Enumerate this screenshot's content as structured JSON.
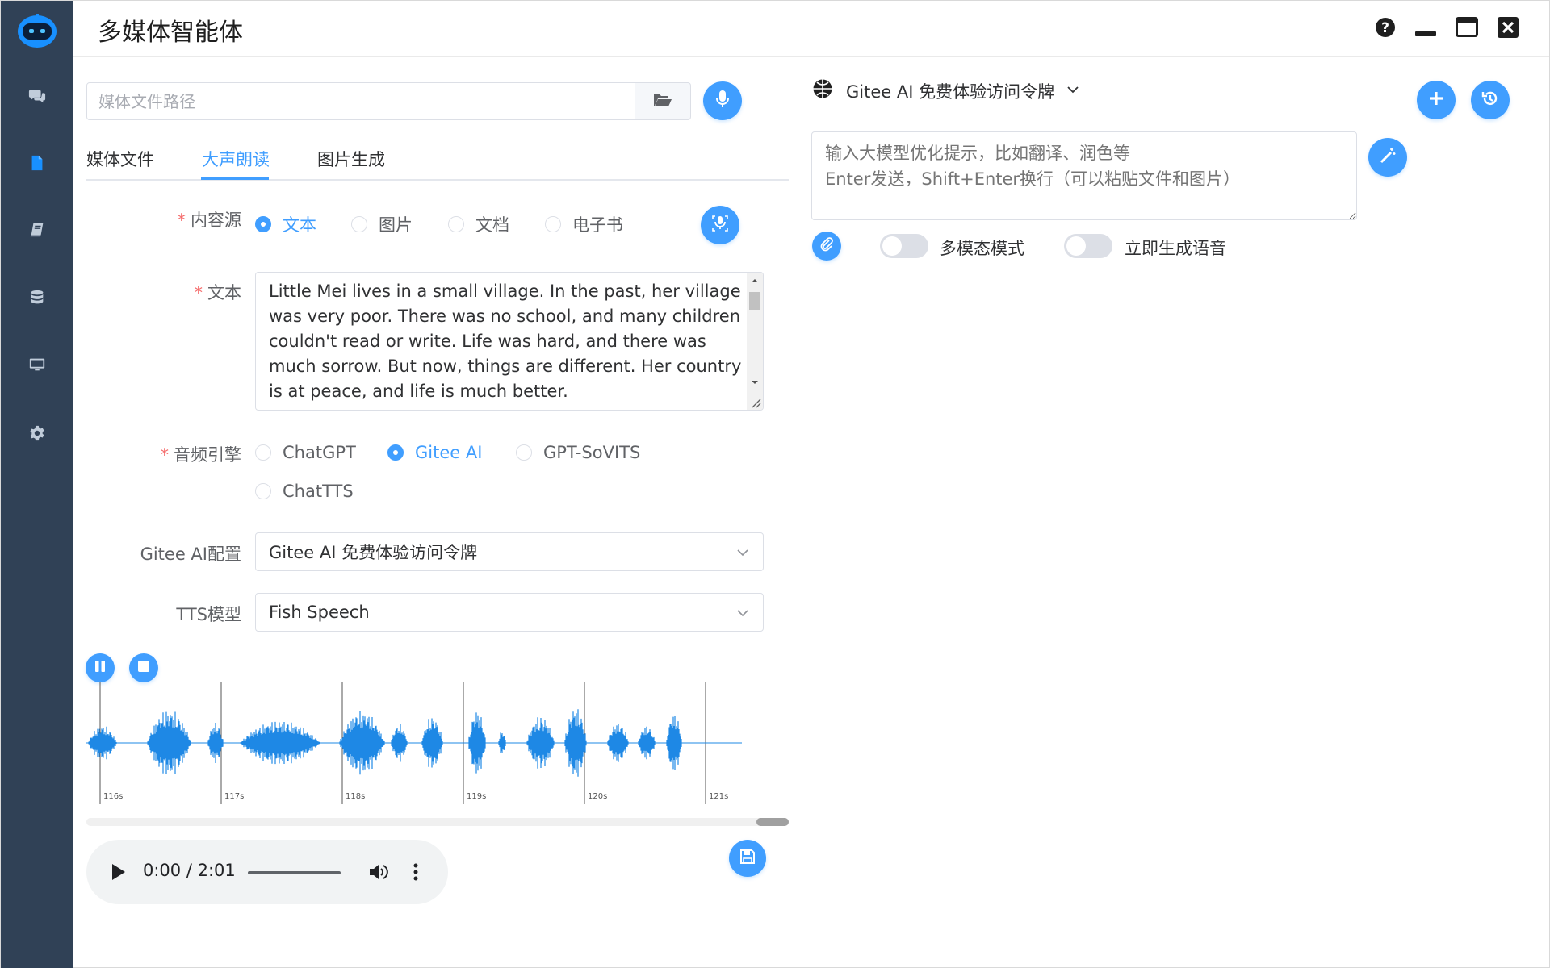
{
  "app": {
    "title": "多媒体智能体"
  },
  "sidebar": {
    "items": [
      {
        "icon": "chat-icon"
      },
      {
        "icon": "document-icon"
      },
      {
        "icon": "book-icon"
      },
      {
        "icon": "database-icon"
      },
      {
        "icon": "monitor-icon"
      },
      {
        "icon": "gear-icon"
      }
    ],
    "active_index": 1
  },
  "left": {
    "path_placeholder": "媒体文件路径",
    "tabs": [
      "媒体文件",
      "大声朗读",
      "图片生成"
    ],
    "active_tab": 1,
    "content_source": {
      "label": "内容源",
      "options": [
        "文本",
        "图片",
        "文档",
        "电子书"
      ],
      "selected": "文本"
    },
    "text": {
      "label": "文本",
      "value": "Little Mei lives in a small village. In the past, her village was very poor. There was no school, and many children couldn't read or write. Life was hard, and there was much sorrow. But now, things are different. Her country is at peace, and life is much better."
    },
    "audio_engine": {
      "label": "音频引擎",
      "options": [
        "ChatGPT",
        "Gitee AI",
        "GPT-SoVITS",
        "ChatTTS"
      ],
      "selected": "Gitee AI"
    },
    "gitee_config": {
      "label": "Gitee AI配置",
      "value": "Gitee AI 免费体验访问令牌"
    },
    "tts_model": {
      "label": "TTS模型",
      "value": "Fish Speech"
    },
    "waveform": {
      "tick_labels": [
        "116s",
        "117s",
        "118s",
        "119s",
        "120s",
        "121s"
      ]
    },
    "player": {
      "time": "0:00 / 2:01",
      "progress": 0
    }
  },
  "right": {
    "model": "Gitee AI 免费体验访问令牌",
    "prompt_placeholder": "输入大模型优化提示，比如翻译、润色等\nEnter发送，Shift+Enter换行（可以粘贴文件和图片）",
    "multimodal_label": "多模态模式",
    "voice_label": "立即生成语音",
    "multimodal_on": false,
    "voice_on": false
  },
  "colors": {
    "accent": "#409eff",
    "sidebar": "#304156",
    "required": "#f56c6c"
  }
}
